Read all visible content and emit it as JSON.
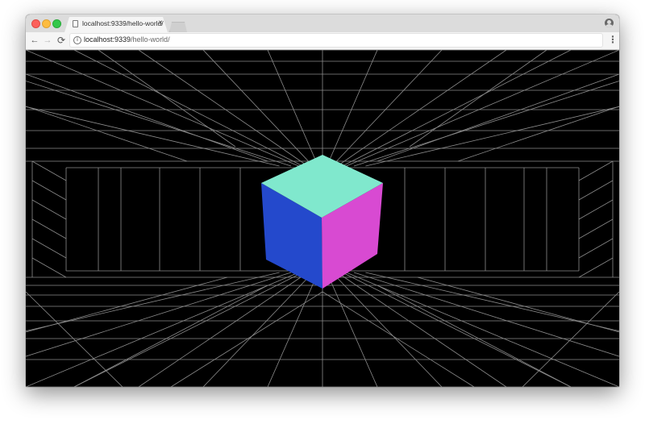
{
  "browser": {
    "tab": {
      "title": "localhost:9339/hello-world/",
      "close_glyph": "×",
      "icon": "document-icon"
    },
    "toolbar": {
      "back_glyph": "←",
      "forward_glyph": "→",
      "reload_glyph": "⟳",
      "info_glyph": "i",
      "url_host": "localhost:9339",
      "url_path": "/hello-world/",
      "star_glyph": "☆",
      "menu_glyph": "⋮"
    },
    "profile_icon": "account-circle-icon"
  },
  "scene": {
    "background_color": "#000000",
    "grid_line_color": "#8c8c8c",
    "cube": {
      "top_face_color": "#80e8cd",
      "left_face_color": "#2449cc",
      "right_face_color": "#d84ad2"
    }
  }
}
